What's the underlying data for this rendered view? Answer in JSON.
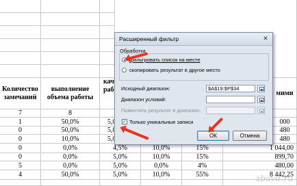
{
  "sheet": {
    "headers": [
      "Количество замечаний",
      "выполнение объема работы",
      "кач",
      "",
      "",
      "",
      "мими"
    ],
    "row_header_suffix_col2": "рабо",
    "rows": [
      [
        "7",
        "8",
        "",
        "",
        "",
        "",
        ""
      ],
      [
        "1",
        "50,0%",
        "5,0",
        "",
        "",
        "",
        "000"
      ],
      [
        "0",
        "50,0%",
        "5,0",
        "",
        "",
        "",
        "480"
      ],
      [
        "0",
        "10,0%",
        "5,0",
        "",
        "",
        "",
        "480"
      ],
      [
        "0",
        "0,0%",
        "4,5%",
        "10,0%",
        "15%",
        "1 044,00",
        ""
      ],
      [
        "0",
        "0,0%",
        "5,0%",
        "10,0%",
        "15%",
        "899,70",
        ""
      ],
      [
        "5",
        "0,0%",
        "5,0%",
        "0,0%",
        "4%",
        "480,00",
        ""
      ],
      [
        "4",
        "50,0%",
        "5,0%",
        "10,0%",
        "55%",
        "8 442,25",
        ""
      ]
    ]
  },
  "dialog": {
    "title": "Расширенный фильтр",
    "close_glyph": "✕",
    "group_label": "Обработка",
    "option_filter_in_place": "фильтровать список на месте",
    "option_copy_to": "скопировать результат в другое место",
    "source_range_label": "Исходный диапазон:",
    "source_range_value": "$A$19:$P$34",
    "criteria_range_label": "Диапазон условий:",
    "criteria_range_value": "",
    "copy_to_label": "Поместить результат в диапазон:",
    "copy_to_value": "",
    "unique_records_label": "Только уникальные записи",
    "unique_records_checked": true,
    "ok_label": "ОК",
    "cancel_label": "Отмена",
    "selected_option": "filter_in_place"
  },
  "watermark": "zbavit.ru"
}
